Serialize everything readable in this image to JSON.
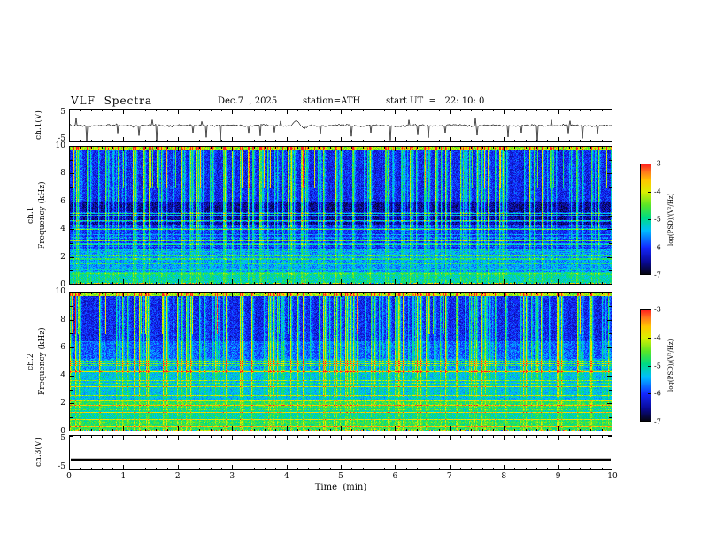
{
  "header": {
    "title": "VLF  Spectra",
    "date": "Dec.7  , 2025",
    "station": "station=ATH",
    "start_ut": "start UT  =   22: 10: 0"
  },
  "axes": {
    "x": {
      "label": "Time  (min)",
      "min": 0,
      "max": 10,
      "ticks": [
        0,
        1,
        2,
        3,
        4,
        5,
        6,
        7,
        8,
        9,
        10
      ]
    },
    "ch1_volt": {
      "label": "ch.1(V)",
      "min": -5,
      "max": 5,
      "ticks": [
        5,
        -5
      ]
    },
    "ch1_freq": {
      "label_channel": "ch.1",
      "label_axis": "Frequency  (kHz)",
      "min": 0,
      "max": 10,
      "ticks": [
        0,
        2,
        4,
        6,
        8,
        10
      ]
    },
    "ch2_freq": {
      "label_channel": "ch.2",
      "label_axis": "Frequency  (kHz)",
      "min": 0,
      "max": 10,
      "ticks": [
        0,
        2,
        4,
        6,
        8,
        10
      ]
    },
    "ch3_volt": {
      "label": "ch.3(V)",
      "min": -5,
      "max": 5,
      "ticks": [
        5,
        -5
      ]
    }
  },
  "colorbar": {
    "label": "log(PSD)/(V²/Hz)",
    "min": -7,
    "max": -3,
    "ticks": [
      -3,
      -4,
      -5,
      -6,
      -7
    ]
  },
  "chart_data": [
    {
      "type": "line",
      "name": "ch1_waveform",
      "title": "ch.1 voltage vs time",
      "x_range": [
        0,
        10
      ],
      "ylim": [
        -5,
        5
      ],
      "baseline": 0,
      "noise_amplitude": 0.45,
      "burst_time_min": 4.2,
      "spike_times_min": [
        0.32,
        0.9,
        1.28,
        1.62,
        2.28,
        2.52,
        2.78,
        3.3,
        3.52,
        3.78,
        4.62,
        5.2,
        5.55,
        5.92,
        6.42,
        6.62,
        6.92,
        7.5,
        8.08,
        8.32,
        8.62,
        9.18,
        9.45,
        9.72
      ],
      "spike_depths_v": [
        -4.5,
        -2.5,
        -3.0,
        -4.8,
        -2.2,
        -3.5,
        -4.6,
        -2.4,
        -3.1,
        -2.0,
        -2.6,
        -3.2,
        -2.1,
        -4.4,
        -2.8,
        -3.6,
        -2.3,
        -2.9,
        -3.4,
        -2.2,
        -4.7,
        -2.5,
        -3.8,
        -2.6
      ]
    },
    {
      "type": "heatmap",
      "name": "ch1_spectrogram",
      "title": "ch.1 spectrogram",
      "x_range": [
        0,
        10
      ],
      "y_range": [
        0,
        10
      ],
      "zlim": [
        -7,
        -3
      ],
      "bands": [
        {
          "f": [
            9.7,
            10
          ],
          "level": -4.4
        },
        {
          "f": [
            6.0,
            9.7
          ],
          "level": -6.2
        },
        {
          "f": [
            4.3,
            6.0
          ],
          "level": -6.65
        },
        {
          "f": [
            2.6,
            4.3
          ],
          "level": -6.1
        },
        {
          "f": [
            0.9,
            2.6
          ],
          "level": -5.6
        },
        {
          "f": [
            0.15,
            0.9
          ],
          "level": -5.15
        },
        {
          "f": [
            0.0,
            0.15
          ],
          "level": -4.6
        }
      ],
      "spectral_lines": [
        {
          "f": 0.5,
          "level": -4.3
        },
        {
          "f": 0.8,
          "level": -4.8
        },
        {
          "f": 1.1,
          "level": -4.5
        },
        {
          "f": 1.5,
          "level": -5.0
        },
        {
          "f": 1.9,
          "level": -4.9
        },
        {
          "f": 2.4,
          "level": -5.3
        },
        {
          "f": 3.0,
          "level": -5.5
        },
        {
          "f": 3.6,
          "level": -5.6
        },
        {
          "f": 4.6,
          "level": -6.0
        },
        {
          "f": 5.2,
          "level": -6.1
        }
      ],
      "sferic_stripe_density": 0.22
    },
    {
      "type": "heatmap",
      "name": "ch2_spectrogram",
      "title": "ch.2 spectrogram",
      "x_range": [
        0,
        10
      ],
      "y_range": [
        0,
        10
      ],
      "zlim": [
        -7,
        -3
      ],
      "bands": [
        {
          "f": [
            9.7,
            10
          ],
          "level": -4.4
        },
        {
          "f": [
            6.5,
            9.7
          ],
          "level": -6.2
        },
        {
          "f": [
            5.2,
            6.5
          ],
          "level": -5.9
        },
        {
          "f": [
            4.2,
            5.2
          ],
          "level": -5.65
        },
        {
          "f": [
            2.3,
            4.2
          ],
          "level": -5.4
        },
        {
          "f": [
            1.7,
            2.3
          ],
          "level": -4.8
        },
        {
          "f": [
            0.8,
            1.7
          ],
          "level": -5.1
        },
        {
          "f": [
            0.15,
            0.8
          ],
          "level": -4.8
        },
        {
          "f": [
            0.0,
            0.15
          ],
          "level": -4.5
        }
      ],
      "spectral_lines": [
        {
          "f": 0.35,
          "level": -3.7
        },
        {
          "f": 0.9,
          "level": -4.0
        },
        {
          "f": 1.4,
          "level": -3.8
        },
        {
          "f": 1.9,
          "level": -3.6
        },
        {
          "f": 2.2,
          "level": -4.1
        },
        {
          "f": 2.6,
          "level": -4.4
        },
        {
          "f": 3.2,
          "level": -4.2
        },
        {
          "f": 3.7,
          "level": -4.5
        },
        {
          "f": 4.3,
          "level": -3.9
        },
        {
          "f": 4.9,
          "level": -4.6
        },
        {
          "f": 5.6,
          "level": -5.2
        }
      ],
      "sferic_stripe_density": 0.2
    },
    {
      "type": "line",
      "name": "ch3_waveform",
      "title": "ch.3 voltage vs time",
      "x_range": [
        0,
        10
      ],
      "ylim": [
        -5,
        5
      ],
      "constant_value": -2
    }
  ]
}
